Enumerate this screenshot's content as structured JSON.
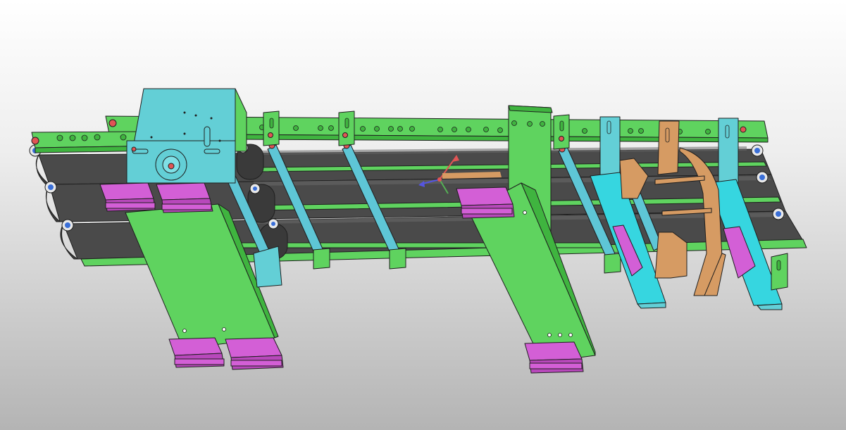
{
  "viewport": {
    "background_top": "#ffffff",
    "background_bottom": "#b4b4b4"
  },
  "colors": {
    "frame_green": "#5fd35f",
    "frame_green_dark": "#3fb43f",
    "plate_cyan": "#63cfd6",
    "bracket_cyan": "#36d6e0",
    "roller_teal": "#5ec6d6",
    "belt_gray": "#4a4a4a",
    "belt_gray_light": "#6b6b6b",
    "foot_magenta": "#d35fd6",
    "guide_tan": "#d69b63",
    "bolt_red": "#e05555",
    "bearing_blue": "#3a6fd8",
    "outline": "#1f1f1f"
  },
  "triad": {
    "x_axis_color": "#e05555",
    "y_axis_color": "#55b055",
    "z_axis_color": "#5555e0"
  },
  "components": [
    "conveyor-frame",
    "drive-motor-plate",
    "belt-lanes",
    "support-rollers",
    "leveling-feet",
    "support-legs",
    "product-guides",
    "side-brackets",
    "coordinate-triad"
  ]
}
